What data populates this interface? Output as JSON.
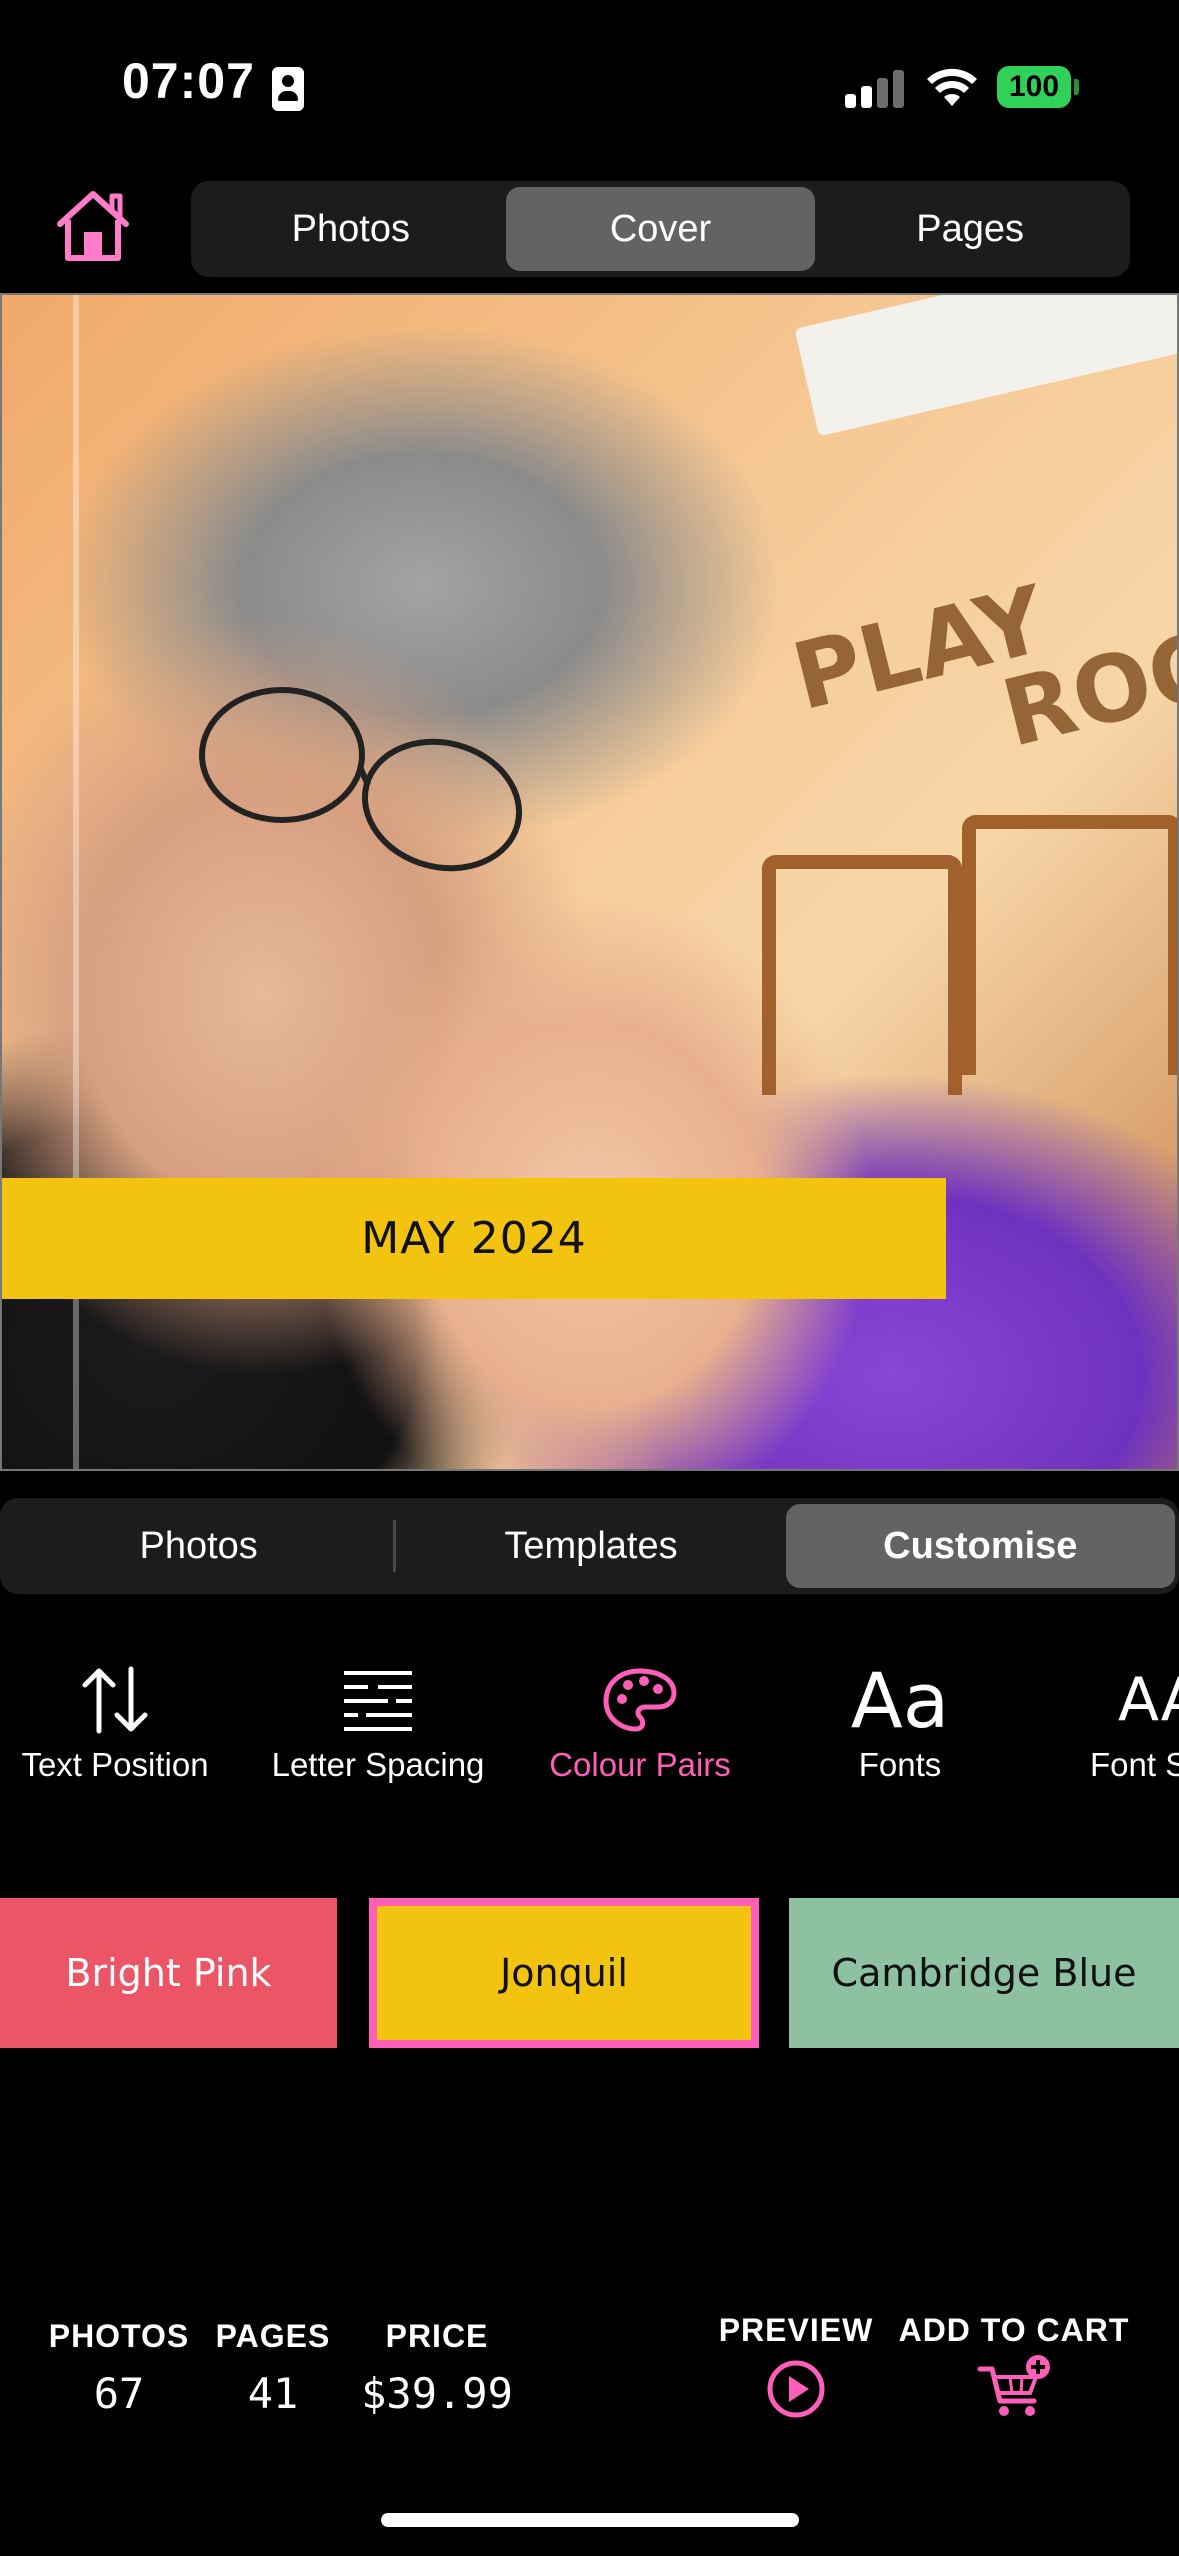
{
  "status_bar": {
    "time": "07:07",
    "battery": "100"
  },
  "top_tabs": [
    {
      "label": "Photos",
      "active": false
    },
    {
      "label": "Cover",
      "active": true
    },
    {
      "label": "Pages",
      "active": false
    }
  ],
  "cover": {
    "caption": "MAY 2024",
    "caption_bg": "#f2c40f",
    "wall_text": [
      "PLAY",
      "ROO"
    ]
  },
  "editor_tabs": [
    {
      "label": "Photos",
      "active": false
    },
    {
      "label": "Templates",
      "active": false
    },
    {
      "label": "Customise",
      "active": true
    }
  ],
  "tools": [
    {
      "label": "Text Position",
      "icon": "arrows-up-down-icon",
      "active": false
    },
    {
      "label": "Letter Spacing",
      "icon": "letter-spacing-icon",
      "active": false
    },
    {
      "label": "Colour Pairs",
      "icon": "palette-icon",
      "active": true
    },
    {
      "label": "Fonts",
      "icon": "Aa",
      "active": false
    },
    {
      "label": "Font S",
      "icon": "AA",
      "active": false
    }
  ],
  "colour_pairs": [
    {
      "label": "Bright Pink",
      "bg": "#ec5566",
      "fg": "#ffffff",
      "selected": false
    },
    {
      "label": "Jonquil",
      "bg": "#f2c40f",
      "fg": "#111111",
      "selected": true
    },
    {
      "label": "Cambridge Blue",
      "bg": "#8ec1a1",
      "fg": "#111111",
      "selected": false
    }
  ],
  "summary": {
    "photos_label": "PHOTOS",
    "photos_value": "67",
    "pages_label": "PAGES",
    "pages_value": "41",
    "price_label": "PRICE",
    "price_value": "$39.99"
  },
  "actions": {
    "preview_label": "PREVIEW",
    "add_to_cart_label": "ADD TO CART"
  },
  "colors": {
    "accent": "#ff5eb9",
    "segment_bg": "#1c1c1e",
    "segment_active": "#636366"
  }
}
